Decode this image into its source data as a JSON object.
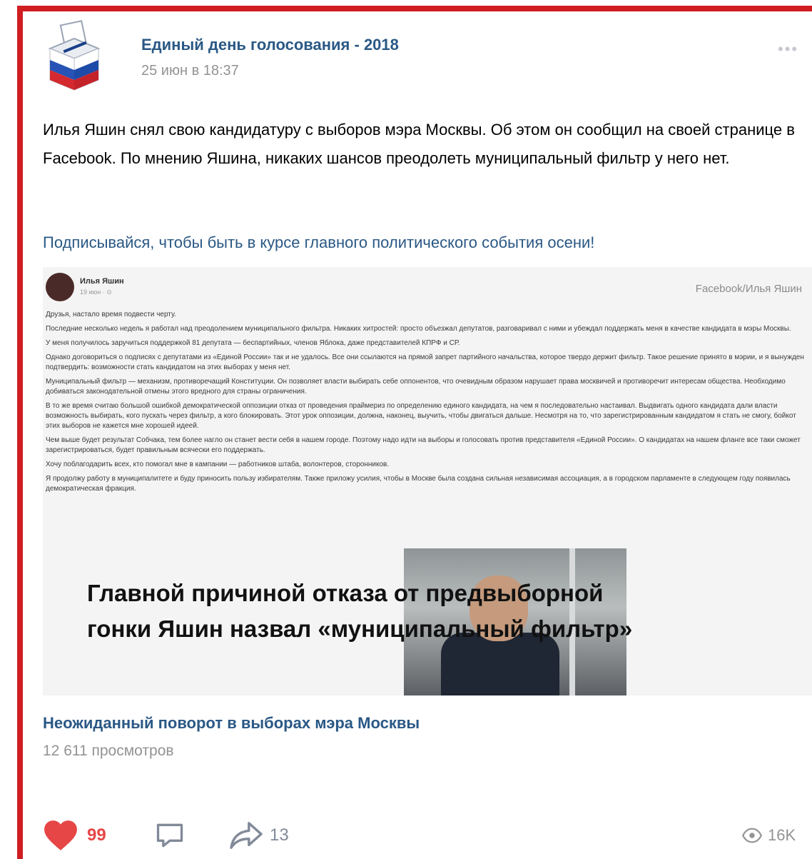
{
  "post": {
    "author": "Единый день голосования - 2018",
    "date": "25 июн в 18:37",
    "text": "Илья Яшин снял свою кандидатуру с выборов мэра Москвы. Об этом он сообщил на своей странице в Facebook. По мнению Яшина, никаких шансов преодолеть муниципальный фильтр у него нет.",
    "link_text": "Подписывайся, чтобы быть в курсе главного политического события осени!"
  },
  "attachment": {
    "fb_name": "Илья Яшин",
    "fb_meta": "19 июн · ⊙",
    "fb_source": "Facebook/Илья Яшин",
    "fb_paragraphs": [
      "Друзья, настало время подвести черту.",
      "Последние несколько недель я работал над преодолением муниципального фильтра. Никаких хитростей: просто объезжал депутатов, разговаривал с ними и убеждал поддержать меня в качестве кандидата в мэры Москвы.",
      "У меня получилось заручиться поддержкой 81 депутата — беспартийных, членов Яблока, даже представителей КПРФ и СР.",
      "Однако договориться о подписях с депутатами из «Единой России» так и не удалось. Все они ссылаются на прямой запрет партийного начальства, которое твердо держит фильтр. Такое решение принято в мэрии, и я вынужден подтвердить: возможности стать кандидатом на этих выборах у меня нет.",
      "Муниципальный фильтр — механизм, противоречащий Конституции. Он позволяет власти выбирать себе оппонентов, что очевидным образом нарушает права москвичей и противоречит интересам общества. Необходимо добиваться законодательной отмены этого вредного для страны ограничения.",
      "В то же время считаю большой ошибкой демократической оппозиции отказ от проведения праймериз по определению единого кандидата, на чем я последовательно настаивал. Выдвигать одного кандидата дали власти возможность выбирать, кого пускать через фильтр, а кого блокировать. Этот урок оппозиции, должна, наконец, выучить, чтобы двигаться дальше. Несмотря на то, что зарегистрированным кандидатом я стать не смогу, бойкот этих выборов не кажется мне хорошей идеей.",
      "Чем выше будет результат Собчака, тем более нагло он станет вести себя в нашем городе. Поэтому надо идти на выборы и голосовать против представителя «Единой России». О кандидатах на нашем фланге все таки сможет зарегистрироваться, будет правильным всячески его поддержать.",
      "Хочу поблагодарить всех, кто помогал мне в кампании — работников штаба, волонтеров, сторонников.",
      "Я продолжу работу в муниципалитете и буду приносить пользу избирателям. Также приложу усилия, чтобы в Москве была создана сильная независимая ассоциация, а в городском парламенте в следующем году появилась демократическая фракция."
    ],
    "headline_line1": "Главной причиной отказа от предвыборной",
    "headline_line2": "гонки Яшин назвал «муниципальный фильтр»",
    "video_title": "Неожиданный поворот в выборах мэра Москвы",
    "video_views": "12 611 просмотров"
  },
  "actions": {
    "likes": "99",
    "shares": "13",
    "views": "16K"
  },
  "icons": {
    "like": "heart-icon",
    "comment": "comment-icon",
    "share": "share-icon",
    "views": "eye-icon",
    "more": "more-icon"
  },
  "colors": {
    "accent_red": "#cf1d22",
    "link_blue": "#2a5885",
    "like_red": "#e64646"
  }
}
